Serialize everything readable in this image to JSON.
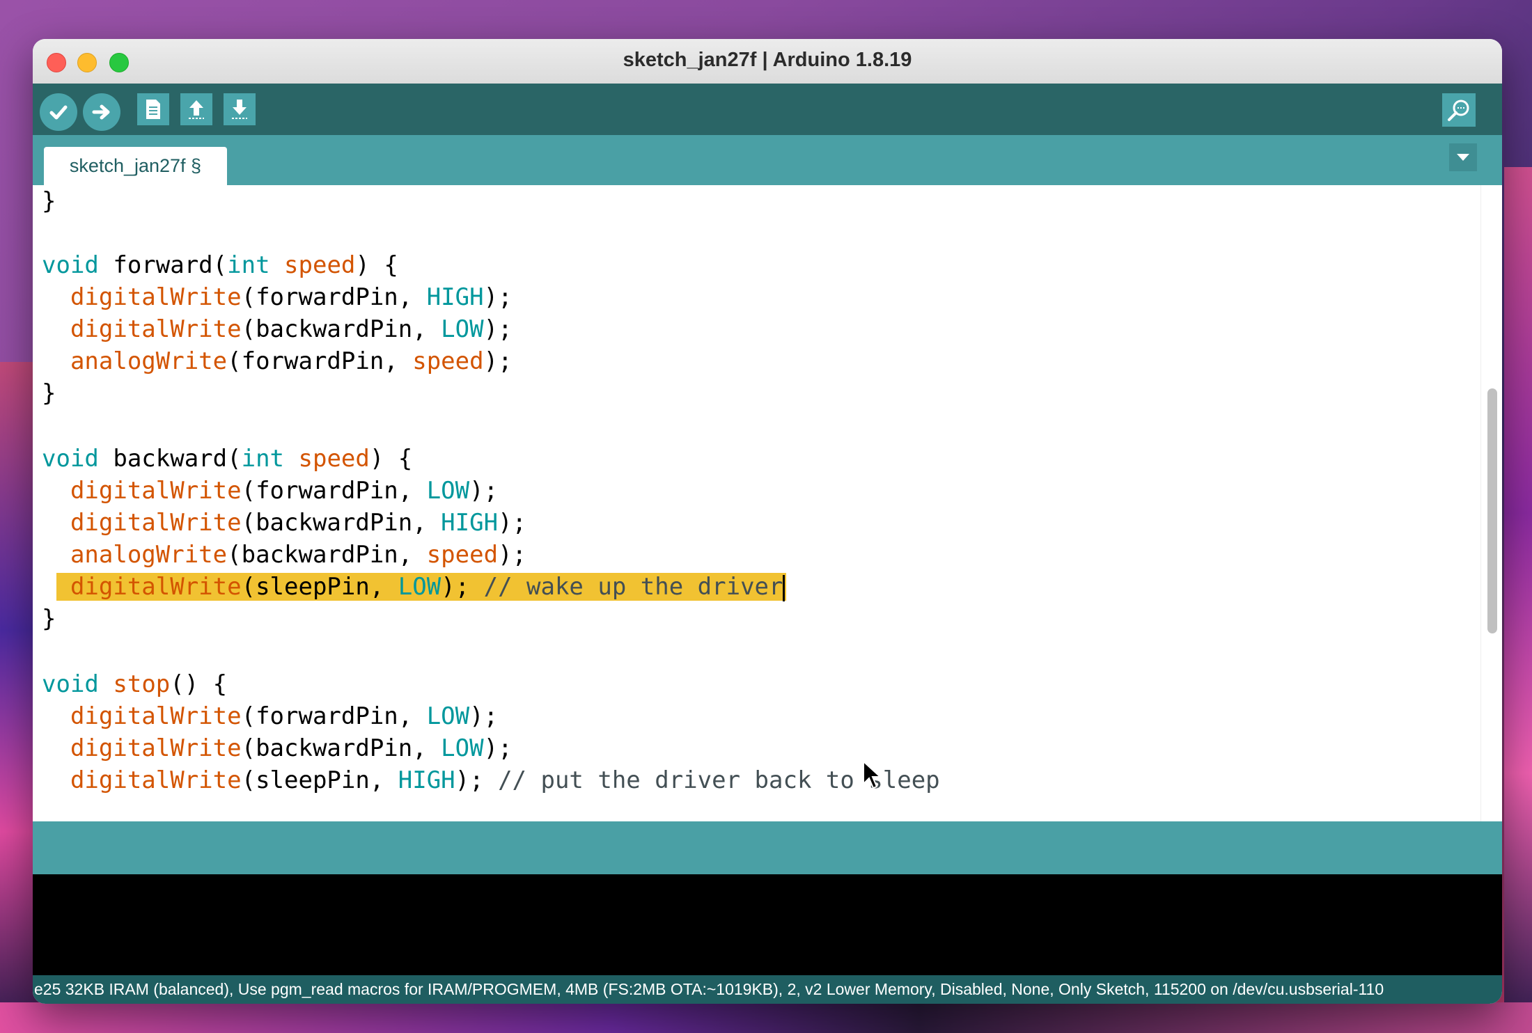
{
  "window": {
    "title": "sketch_jan27f | Arduino 1.8.19"
  },
  "toolbar": {
    "verify_icon": "check-icon",
    "upload_icon": "arrow-right-icon",
    "new_icon": "document-icon",
    "open_icon": "arrow-up-icon",
    "save_icon": "arrow-down-icon",
    "serial_monitor_icon": "magnifier-icon"
  },
  "tabs": {
    "active_label": "sketch_jan27f §",
    "menu_icon": "triangle-down-icon"
  },
  "editor": {
    "lines": [
      {
        "text": "}"
      },
      {
        "text": ""
      },
      {
        "text": "void forward(int speed) {"
      },
      {
        "text": "  digitalWrite(forwardPin, HIGH);"
      },
      {
        "text": "  digitalWrite(backwardPin, LOW);"
      },
      {
        "text": "  analogWrite(forwardPin, speed);"
      },
      {
        "text": "}"
      },
      {
        "text": ""
      },
      {
        "text": "void backward(int speed) {"
      },
      {
        "text": "  digitalWrite(forwardPin, LOW);"
      },
      {
        "text": "  digitalWrite(backwardPin, HIGH);"
      },
      {
        "text": "  analogWrite(backwardPin, speed);"
      },
      {
        "text": "  digitalWrite(sleepPin, LOW); // wake up the driver"
      },
      {
        "text": "}"
      },
      {
        "text": ""
      },
      {
        "text": "void stop() {"
      },
      {
        "text": "  digitalWrite(forwardPin, LOW);"
      },
      {
        "text": "  digitalWrite(backwardPin, LOW);"
      },
      {
        "text": "  digitalWrite(sleepPin, HIGH); // put the driver back to sleep"
      }
    ],
    "highlighted_line": 12
  },
  "status": {
    "board_info": "e25 32KB IRAM (balanced), Use pgm_read macros for IRAM/PROGMEM, 4MB (FS:2MB OTA:~1019KB), 2, v2 Lower Memory, Disabled, None, Only Sketch, 115200 on /dev/cu.usbserial-110"
  },
  "colors": {
    "toolbar": "#2a6566",
    "tabbar": "#4aa0a5",
    "keyword": "#00979c",
    "function": "#d35400",
    "highlight": "#f1c232"
  }
}
